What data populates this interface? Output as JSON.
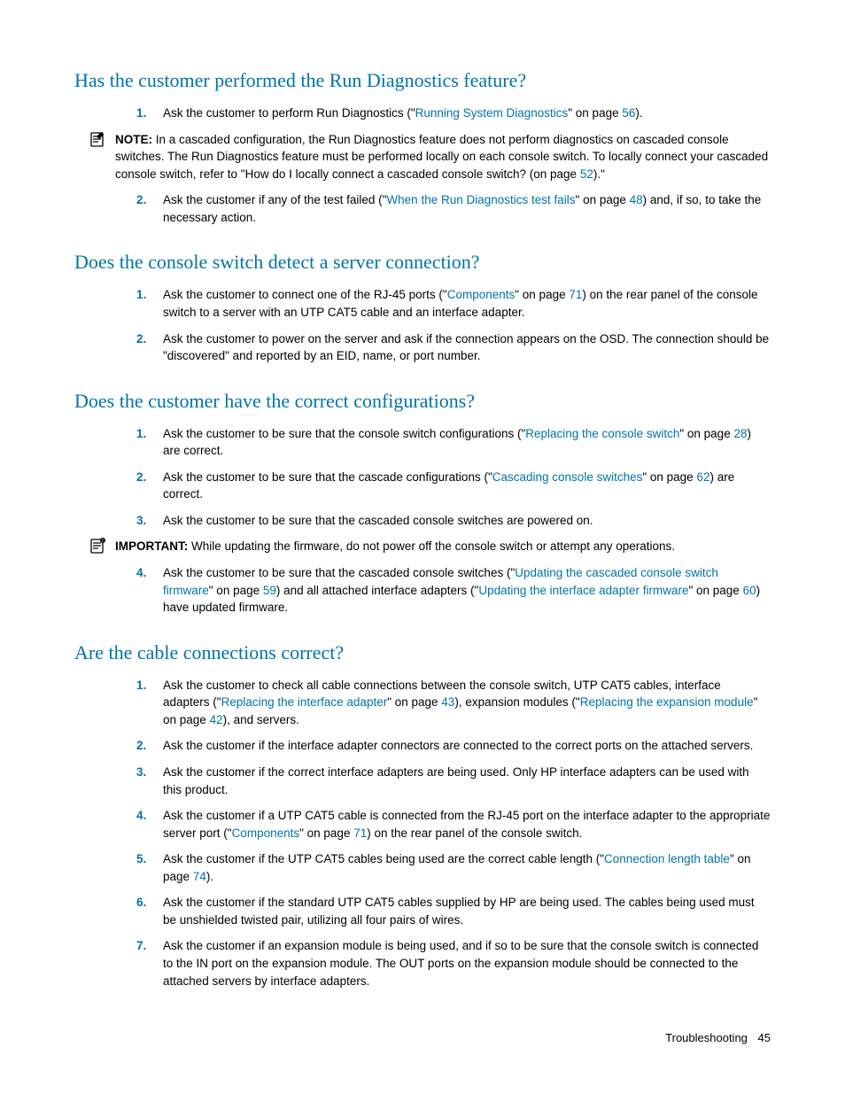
{
  "footer": {
    "section": "Troubleshooting",
    "page": "45"
  },
  "labels": {
    "note": "NOTE:",
    "important": "IMPORTANT:"
  },
  "s1": {
    "heading": "Has the customer performed the Run Diagnostics feature?",
    "i1a": "Ask the customer to perform Run Diagnostics (\"",
    "i1link": "Running System Diagnostics",
    "i1b": "\" on page ",
    "i1pg": "56",
    "i1c": ").",
    "note_a": "In a cascaded configuration, the Run Diagnostics feature does not perform diagnostics on cascaded console switches. The Run Diagnostics feature must be performed locally on each console switch. To locally connect your cascaded console switch, refer to \"How do I locally connect a cascaded console switch? (on page ",
    "note_pg": "52",
    "note_b": ").\"",
    "i2a": "Ask the customer if any of the test failed (\"",
    "i2link": "When the Run Diagnostics test fails",
    "i2b": "\" on page ",
    "i2pg": "48",
    "i2c": ") and, if so, to take the necessary action."
  },
  "s2": {
    "heading": "Does the console switch detect a server connection?",
    "i1a": "Ask the customer to connect one of the RJ-45 ports (\"",
    "i1link": "Components",
    "i1b": "\" on page ",
    "i1pg": "71",
    "i1c": ") on the rear panel of the console switch to a server with an UTP CAT5 cable and an interface adapter.",
    "i2": "Ask the customer to power on the server and ask if the connection appears on the OSD. The connection should be \"discovered\" and reported by an EID, name, or port number."
  },
  "s3": {
    "heading": "Does the customer have the correct configurations?",
    "i1a": "Ask the customer to be sure that the console switch configurations (\"",
    "i1link": "Replacing the console switch",
    "i1b": "\" on page ",
    "i1pg": "28",
    "i1c": ") are correct.",
    "i2a": "Ask the customer to be sure that the cascade configurations (\"",
    "i2link": "Cascading console switches",
    "i2b": "\" on page ",
    "i2pg": "62",
    "i2c": ") are correct.",
    "i3": "Ask the customer to be sure that the cascaded console switches are powered on.",
    "imp": "While updating the firmware, do not power off the console switch or attempt any operations.",
    "i4a": "Ask the customer to be sure that the cascaded console switches (\"",
    "i4link1": "Updating the cascaded console switch firmware",
    "i4b": "\" on page ",
    "i4pg1": "59",
    "i4c": ") and all attached interface adapters (\"",
    "i4link2": "Updating the interface adapter firmware",
    "i4d": "\" on page ",
    "i4pg2": "60",
    "i4e": ") have updated firmware."
  },
  "s4": {
    "heading": "Are the cable connections correct?",
    "i1a": "Ask the customer to check all cable connections between the console switch, UTP CAT5 cables, interface adapters (\"",
    "i1link1": "Replacing the interface adapter",
    "i1b": "\" on page ",
    "i1pg1": "43",
    "i1c": "), expansion modules (\"",
    "i1link2": "Replacing the expansion module",
    "i1d": "\" on page ",
    "i1pg2": "42",
    "i1e": "), and servers.",
    "i2": "Ask the customer if the interface adapter connectors are connected to the correct ports on the attached servers.",
    "i3": "Ask the customer if the correct interface adapters are being used. Only HP interface adapters can be used with this product.",
    "i4a": "Ask the customer if a UTP CAT5 cable is connected from the RJ-45 port on the interface adapter to the appropriate server port (\"",
    "i4link": "Components",
    "i4b": "\" on page ",
    "i4pg": "71",
    "i4c": ") on the rear panel of the console switch.",
    "i5a": "Ask the customer if the UTP CAT5 cables being used are the correct cable length (\"",
    "i5link": "Connection length table",
    "i5b": "\" on page ",
    "i5pg": "74",
    "i5c": ").",
    "i6": "Ask the customer if the standard UTP CAT5 cables supplied by HP are being used. The cables being used must be unshielded twisted pair, utilizing all four pairs of wires.",
    "i7": "Ask the customer if an expansion module is being used, and if so to be sure that the console switch is connected to the IN port on the expansion module. The OUT ports on the expansion module should be connected to the attached servers by interface adapters."
  }
}
